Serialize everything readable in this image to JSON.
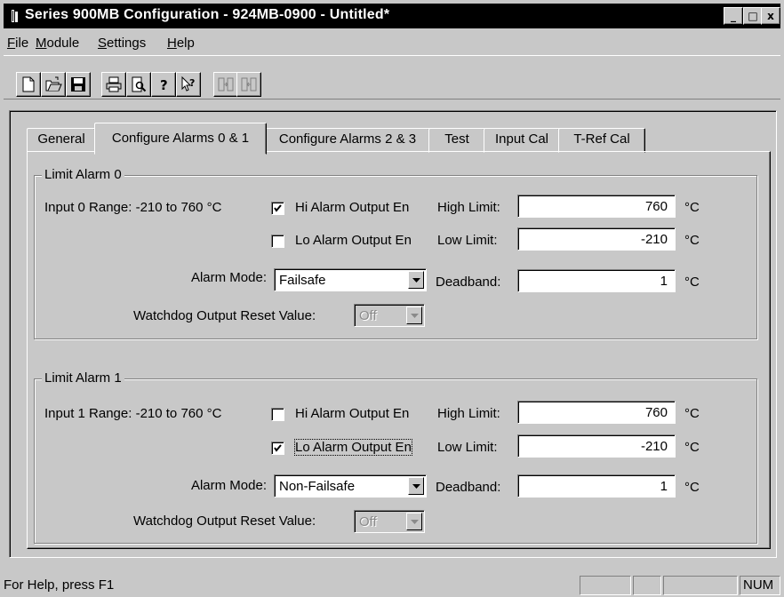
{
  "window": {
    "title": "Series 900MB Configuration - 924MB-0900 - Untitled*",
    "controls": {
      "minimize": "_",
      "maximize": "□",
      "close": "x"
    }
  },
  "menu": {
    "items": [
      {
        "label": "File",
        "mnemonic": "F",
        "rest": "ile"
      },
      {
        "label": "Module",
        "mnemonic": "M",
        "rest": "odule"
      },
      {
        "label": "Settings",
        "mnemonic": "S",
        "rest": "ettings"
      },
      {
        "label": "Help",
        "mnemonic": "H",
        "rest": "elp"
      }
    ]
  },
  "toolbar": {
    "buttons": [
      "new-file-icon",
      "open-folder-icon",
      "save-disk-icon",
      "print-icon",
      "print-preview-icon",
      "about-icon",
      "context-help-icon",
      "upload-config-icon",
      "download-config-icon"
    ]
  },
  "tabs": [
    {
      "label": "General",
      "active": false
    },
    {
      "label": "Configure Alarms 0 & 1",
      "active": true
    },
    {
      "label": "Configure Alarms 2 & 3",
      "active": false
    },
    {
      "label": "Test",
      "active": false
    },
    {
      "label": "Input Cal",
      "active": false
    },
    {
      "label": "T-Ref Cal",
      "active": false
    }
  ],
  "alarm0": {
    "group_title": "Limit Alarm 0",
    "range_text": "Input 0 Range: -210 to 760 °C",
    "hi_output": {
      "label": "Hi Alarm Output En",
      "checked": true
    },
    "lo_output": {
      "label": "Lo Alarm Output En",
      "checked": false
    },
    "high_limit": {
      "label": "High Limit:",
      "value": "760",
      "unit": "°C"
    },
    "low_limit": {
      "label": "Low Limit:",
      "value": "-210",
      "unit": "°C"
    },
    "deadband": {
      "label": "Deadband:",
      "value": "1",
      "unit": "°C"
    },
    "alarm_mode": {
      "label": "Alarm Mode:",
      "value": "Failsafe"
    },
    "watchdog": {
      "label": "Watchdog Output Reset Value:",
      "value": "Off"
    }
  },
  "alarm1": {
    "group_title": "Limit Alarm 1",
    "range_text": "Input 1 Range: -210 to 760 °C",
    "hi_output": {
      "label": "Hi Alarm Output En",
      "checked": false
    },
    "lo_output": {
      "label": "Lo Alarm Output En",
      "checked": true
    },
    "high_limit": {
      "label": "High Limit:",
      "value": "760",
      "unit": "°C"
    },
    "low_limit": {
      "label": "Low Limit:",
      "value": "-210",
      "unit": "°C"
    },
    "deadband": {
      "label": "Deadband:",
      "value": "1",
      "unit": "°C"
    },
    "alarm_mode": {
      "label": "Alarm Mode:",
      "value": "Non-Failsafe"
    },
    "watchdog": {
      "label": "Watchdog Output Reset Value:",
      "value": "Off"
    }
  },
  "status": {
    "text": "For Help, press F1",
    "num": "NUM"
  }
}
